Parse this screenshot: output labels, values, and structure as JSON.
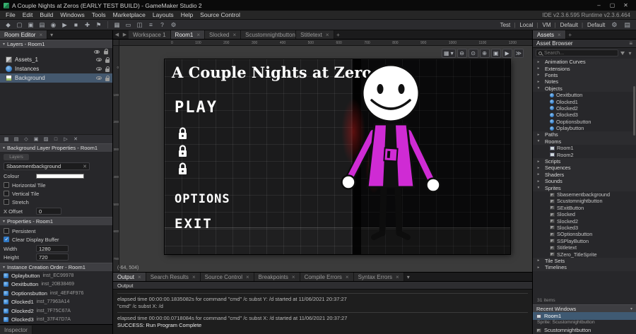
{
  "icons": {
    "close": "✕",
    "minimize": "–",
    "maximize": "▢",
    "chevron_down": "▾",
    "chevron_right": "▸",
    "nav_back": "◀",
    "nav_forward": "▶",
    "plus": "+",
    "hamburger": "≡"
  },
  "colors": {
    "character_body": "#cf2bd4",
    "selection": "#44586e",
    "checkbox_checked": "#2f78c4",
    "recent_selection": "#3f5a73",
    "panel_header": "#3e3e42"
  },
  "window": {
    "title": "A Couple Nights at Zeros (EARLY TEST BUILD) - GameMaker Studio 2",
    "minimize": "–",
    "maximize": "▢",
    "close": "✕"
  },
  "menu_bar": {
    "items": [
      "File",
      "Edit",
      "Build",
      "Windows",
      "Tools",
      "Marketplace",
      "Layouts",
      "Help",
      "Source Control"
    ],
    "version": "IDE v2.3.6.595   Runtime v2.3.6.464"
  },
  "toolbar": {
    "left_icons": [
      {
        "name": "home-button",
        "glyph": "◆"
      },
      {
        "name": "new-project-button",
        "glyph": "▢"
      },
      {
        "name": "open-project-button",
        "glyph": "▣"
      },
      {
        "name": "save-project-button",
        "glyph": "▤"
      },
      {
        "name": "debug-button",
        "glyph": "◉"
      },
      {
        "name": "run-button",
        "glyph": "▶"
      },
      {
        "name": "stop-button",
        "glyph": "■"
      },
      {
        "name": "clean-button",
        "glyph": "✚"
      },
      {
        "name": "target-button",
        "glyph": "⚑"
      }
    ],
    "mid_icons": [
      {
        "name": "windows-layout-button",
        "glyph": "▦"
      },
      {
        "name": "workspace-button",
        "glyph": "▭"
      },
      {
        "name": "split-view-button",
        "glyph": "◫"
      },
      {
        "name": "list-button",
        "glyph": "≡"
      },
      {
        "name": "help-button",
        "glyph": "?"
      },
      {
        "name": "settings-button",
        "glyph": "⚙"
      }
    ],
    "targets": [
      "Test",
      "Local",
      "VM",
      "Default",
      "Default"
    ],
    "target_settings_glyph": "⚙",
    "layout_glyph": "▤"
  },
  "left_panel": {
    "tab": "Room Editor",
    "layers": {
      "header": "Layers - Room1",
      "items": [
        {
          "label": "Assets_1",
          "kind": "assets"
        },
        {
          "label": "Instances",
          "kind": "instances"
        },
        {
          "label": "Background",
          "kind": "background",
          "selected": true
        }
      ]
    },
    "layer_toolbar": [
      {
        "name": "add-instance-layer-button",
        "glyph": "▦"
      },
      {
        "name": "add-tile-layer-button",
        "glyph": "▤"
      },
      {
        "name": "add-path-layer-button",
        "glyph": "◇"
      },
      {
        "name": "add-asset-layer-button",
        "glyph": "▣"
      },
      {
        "name": "add-background-layer-button",
        "glyph": "▨"
      },
      {
        "name": "add-effect-layer-button",
        "glyph": "□"
      },
      {
        "name": "add-folder-button",
        "glyph": "▷"
      },
      {
        "name": "delete-layer-button",
        "glyph": "✕"
      }
    ],
    "background_properties": {
      "header": "Background Layer Properties - Room1",
      "pill": "Layers",
      "sprite": "Sbasementbackground",
      "colour_label": "Colour",
      "checkboxes": [
        {
          "label": "Horizontal Tile",
          "checked": false
        },
        {
          "label": "Vertical Tile",
          "checked": false
        },
        {
          "label": "Stretch",
          "checked": false
        }
      ],
      "x_offset_label": "X Offset",
      "x_offset_value": "0"
    },
    "properties": {
      "header": "Properties - Room1",
      "checkboxes": [
        {
          "label": "Persistent",
          "checked": false
        },
        {
          "label": "Clear Display Buffer",
          "checked": true
        }
      ],
      "fields": [
        {
          "label": "Width",
          "value": "1280"
        },
        {
          "label": "Height",
          "value": "720"
        }
      ]
    },
    "instance_order": {
      "header": "Instance Creation Order - Room1",
      "items": [
        {
          "obj": "Oplaybutton",
          "id": "inst_EC99978"
        },
        {
          "obj": "Oexitbutton",
          "id": "inst_20B38469"
        },
        {
          "obj": "Ooptionsbutton",
          "id": "inst_4EF4F976"
        },
        {
          "obj": "Olocked1",
          "id": "inst_77963A14"
        },
        {
          "obj": "Olocked2",
          "id": "inst_7F75C67A"
        },
        {
          "obj": "Olocked3",
          "id": "inst_37F47D7A"
        }
      ]
    },
    "inspector_tab": "Inspector"
  },
  "workspace": {
    "tabs": [
      {
        "label": "Workspace 1",
        "closable": false
      },
      {
        "label": "Room1",
        "active": true,
        "closable": true
      },
      {
        "label": "Slocked",
        "closable": true
      },
      {
        "label": "Scustomnightbutton",
        "closable": true
      },
      {
        "label": "Stitletext",
        "closable": true
      }
    ]
  },
  "canvas": {
    "tools": [
      {
        "name": "grid-settings-button",
        "glyph": "▦ ▾"
      },
      {
        "name": "zoom-out-button",
        "glyph": "⊖"
      },
      {
        "name": "zoom-reset-button",
        "glyph": "⊙"
      },
      {
        "name": "zoom-in-button",
        "glyph": "⊕"
      },
      {
        "name": "zoom-fit-button",
        "glyph": "▣"
      },
      {
        "name": "play-room-button",
        "glyph": "▶"
      },
      {
        "name": "step-room-button",
        "glyph": "≫"
      }
    ],
    "h_ticks": [
      "0",
      "100",
      "200",
      "300",
      "400",
      "500",
      "600",
      "700",
      "800",
      "900",
      "1000",
      "1100",
      "1200"
    ],
    "v_ticks": [
      "0",
      "100",
      "200",
      "300",
      "400",
      "500",
      "600",
      "700"
    ],
    "coords": "(-64, 504)"
  },
  "game": {
    "title": "A Couple Nights at Zeros",
    "play_label": "PLAY",
    "options_label": "OPTIONS",
    "exit_label": "EXIT",
    "lock_count": 3
  },
  "output": {
    "tabs": [
      {
        "label": "Output",
        "active": true,
        "closable": true
      },
      {
        "label": "Search Results",
        "closable": true
      },
      {
        "label": "Source Control",
        "closable": true
      },
      {
        "label": "Breakpoints",
        "closable": true
      },
      {
        "label": "Compile Errors",
        "closable": true
      },
      {
        "label": "Syntax Errors",
        "closable": true
      }
    ],
    "header": "Output",
    "lines": [
      {
        "text": "elapsed time 00:00:00.1835082s for command \"cmd\" /c subst Y: /d started at 11/06/2021 20:37:27",
        "sep": true
      },
      {
        "text": "\"cmd\" /c subst X: /d"
      },
      {
        "text": "elapsed time 00:00:00.0718084s for command \"cmd\" /c subst X: /d started at 11/06/2021 20:37:27",
        "sep": true
      },
      {
        "text": "SUCCESS: Run Program Complete",
        "strong": true
      }
    ]
  },
  "asset_browser": {
    "tab": "Assets",
    "header": "Asset Browser",
    "search_placeholder": "Search...",
    "tree": [
      {
        "label": "Animation Curves",
        "arrow": "closed",
        "indent": 0,
        "kind": "group"
      },
      {
        "label": "Extensions",
        "arrow": "closed",
        "indent": 0,
        "kind": "group"
      },
      {
        "label": "Fonts",
        "arrow": "closed",
        "indent": 0,
        "kind": "group"
      },
      {
        "label": "Notes",
        "arrow": "closed",
        "indent": 0,
        "kind": "group"
      },
      {
        "label": "Objects",
        "arrow": "open",
        "indent": 0,
        "kind": "group"
      },
      {
        "label": "Oexitbutton",
        "indent": 1,
        "kind": "object"
      },
      {
        "label": "Olocked1",
        "indent": 1,
        "kind": "object"
      },
      {
        "label": "Olocked2",
        "indent": 1,
        "kind": "object"
      },
      {
        "label": "Olocked3",
        "indent": 1,
        "kind": "object"
      },
      {
        "label": "Ooptionsbutton",
        "indent": 1,
        "kind": "object"
      },
      {
        "label": "Oplaybutton",
        "indent": 1,
        "kind": "object"
      },
      {
        "label": "Paths",
        "arrow": "closed",
        "indent": 0,
        "kind": "group"
      },
      {
        "label": "Rooms",
        "arrow": "open",
        "indent": 0,
        "kind": "group"
      },
      {
        "label": "Room1",
        "indent": 1,
        "kind": "room"
      },
      {
        "label": "Room2",
        "indent": 1,
        "kind": "room"
      },
      {
        "label": "Scripts",
        "arrow": "closed",
        "indent": 0,
        "kind": "group"
      },
      {
        "label": "Sequences",
        "arrow": "closed",
        "indent": 0,
        "kind": "group"
      },
      {
        "label": "Shaders",
        "arrow": "closed",
        "indent": 0,
        "kind": "group"
      },
      {
        "label": "Sounds",
        "arrow": "closed",
        "indent": 0,
        "kind": "group"
      },
      {
        "label": "Sprites",
        "arrow": "open",
        "indent": 0,
        "kind": "group"
      },
      {
        "label": "Sbasementbackground",
        "indent": 1,
        "kind": "sprite"
      },
      {
        "label": "Scustomnightbutton",
        "indent": 1,
        "kind": "sprite"
      },
      {
        "label": "SExitButton",
        "indent": 1,
        "kind": "sprite"
      },
      {
        "label": "Slocked",
        "indent": 1,
        "kind": "sprite"
      },
      {
        "label": "Slocked2",
        "indent": 1,
        "kind": "sprite"
      },
      {
        "label": "Slocked3",
        "indent": 1,
        "kind": "sprite"
      },
      {
        "label": "SOptionsbutton",
        "indent": 1,
        "kind": "sprite"
      },
      {
        "label": "SSPlayButton",
        "indent": 1,
        "kind": "sprite"
      },
      {
        "label": "Stitletext",
        "indent": 1,
        "kind": "sprite"
      },
      {
        "label": "SZero_TitleSprite",
        "indent": 1,
        "kind": "sprite"
      },
      {
        "label": "Tile Sets",
        "arrow": "closed",
        "indent": 0,
        "kind": "group"
      },
      {
        "label": "Timelines",
        "arrow": "closed",
        "indent": 0,
        "kind": "group"
      }
    ],
    "items_count": "31 items",
    "recent": {
      "header": "Recent Windows",
      "room_item": "Room1",
      "caption": "Sprite: Scustomnightbutton",
      "sprite_item": "Scustomnightbutton"
    }
  }
}
